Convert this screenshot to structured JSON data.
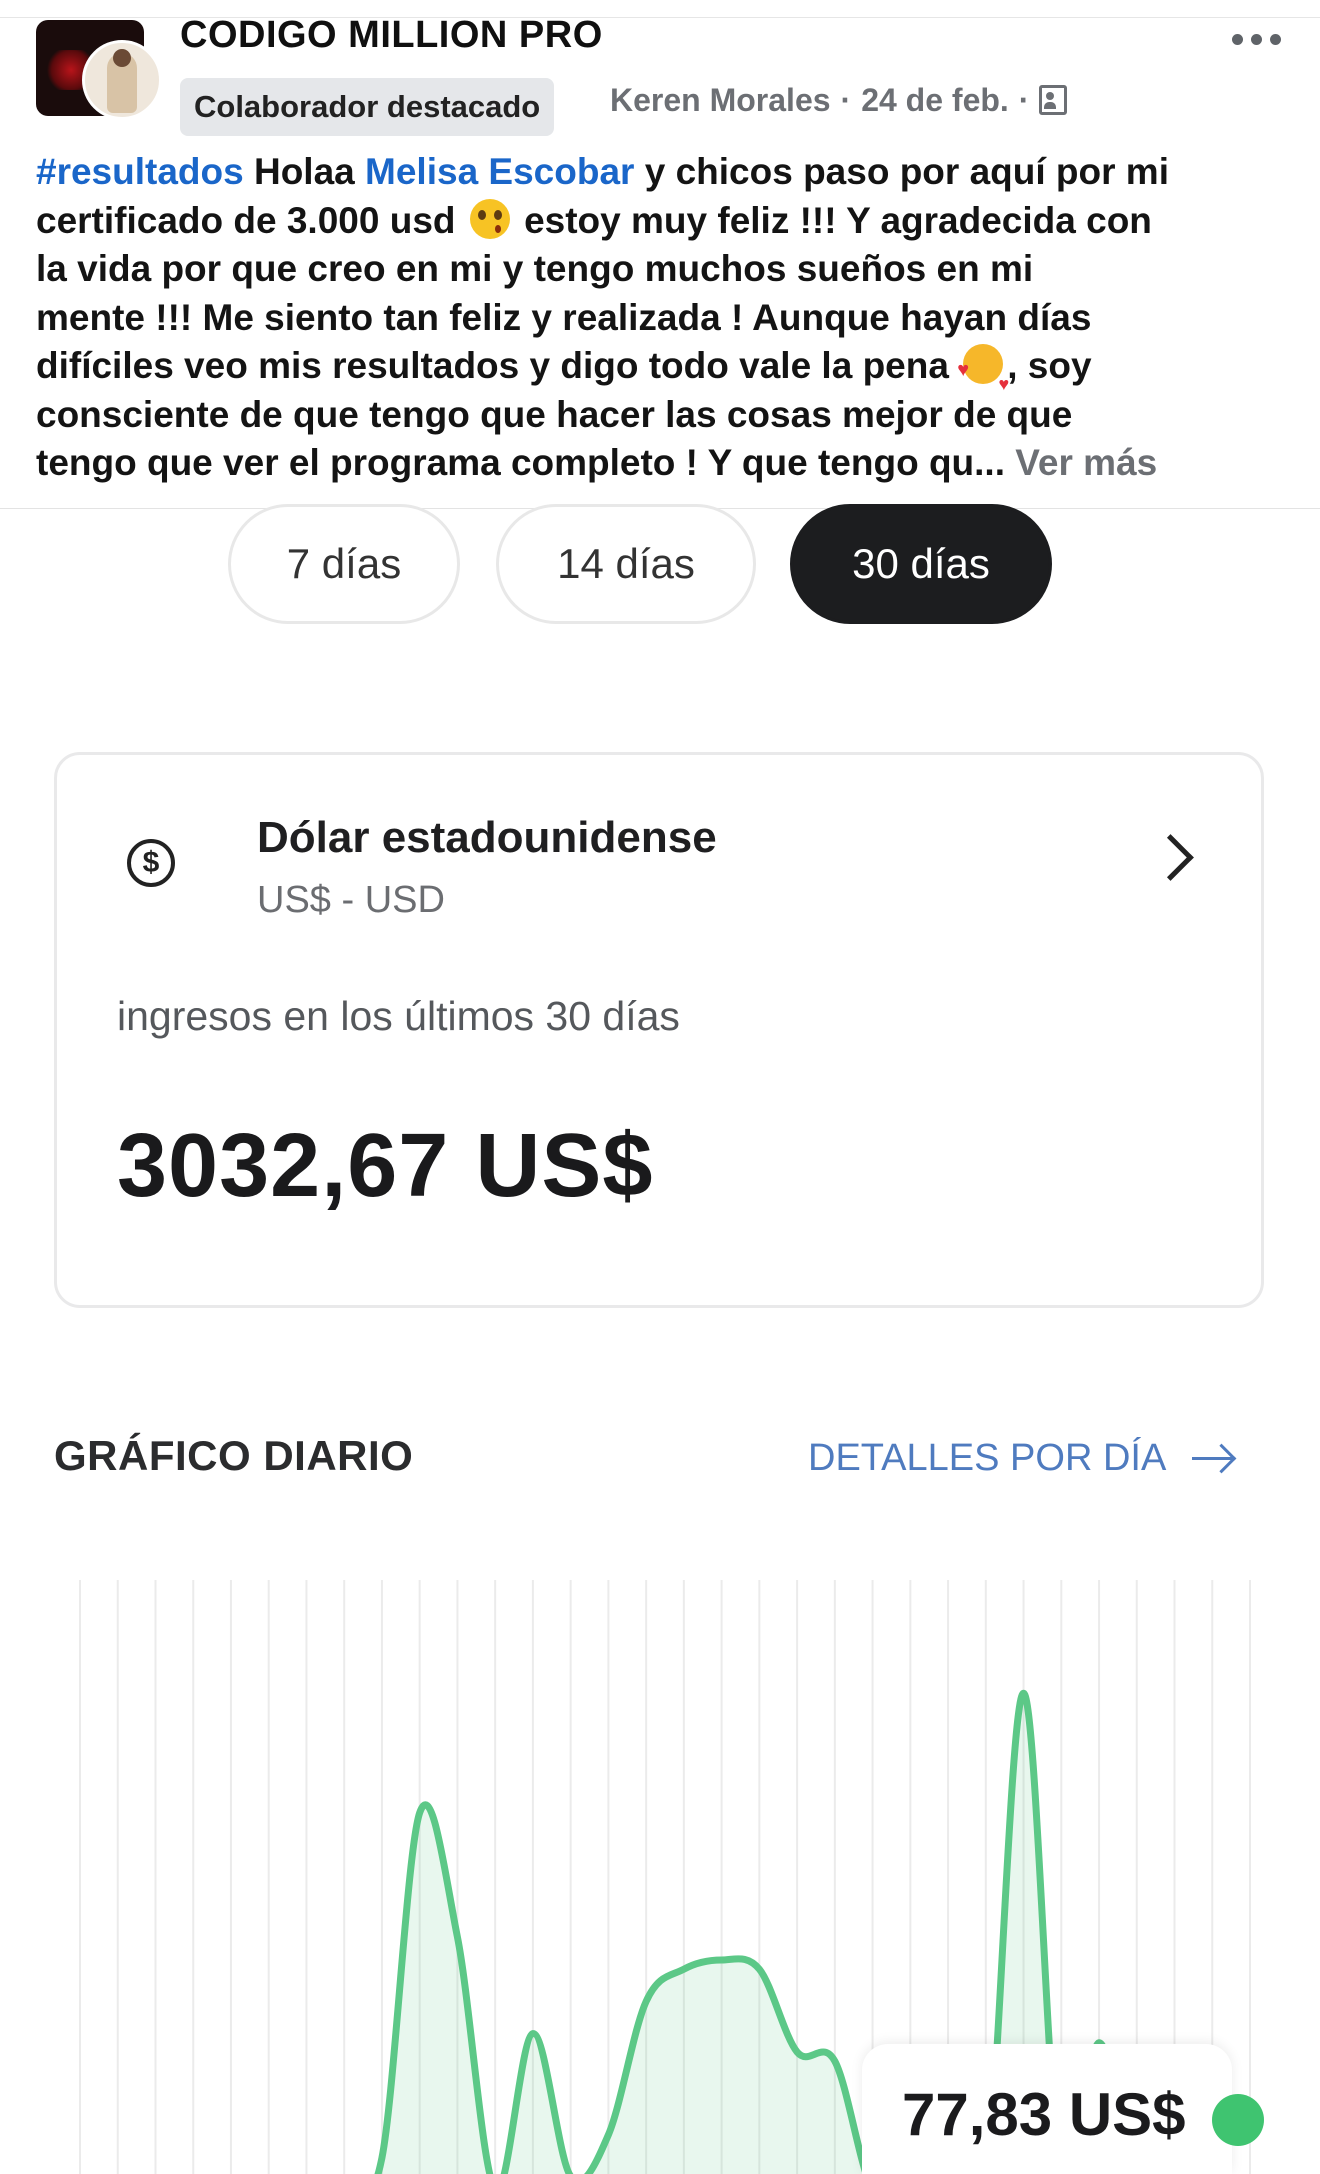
{
  "post": {
    "group_name": "CODIGO MILLION PRO",
    "badge": "Colaborador destacado",
    "author": "Keren Morales",
    "separator": "·",
    "date": "24 de feb.",
    "text_lines": [
      [
        "#resultados",
        " Holaa ",
        "Melisa Escobar",
        " y chicos paso por aquí por mi"
      ],
      [
        "certificado de 3.000 usd ",
        "",
        " estoy muy feliz !!! Y agradecida con"
      ],
      [
        "la vida por que creo en mi y tengo muchos sueños en mi"
      ],
      [
        "mente !!! Me siento tan feliz y realizada ! Aunque hayan días"
      ],
      [
        "difíciles veo mis resultados y digo todo vale la pena ",
        "",
        ", soy"
      ],
      [
        "consciente de que tengo que hacer las cosas mejor de que"
      ],
      [
        "tengo que ver el programa completo ! Y que tengo qu... ",
        "Ver más"
      ]
    ],
    "hashtag": "#resultados",
    "mention": "Melisa Escobar",
    "see_more": "Ver más",
    "icons": {
      "more": "more-horizontal-icon",
      "privacy": "group-members-icon",
      "emoji_1": "loudly-crying-face-emoji",
      "emoji_2": "smiling-face-with-hearts-emoji"
    }
  },
  "range_tabs": [
    {
      "label": "7 días",
      "active": false
    },
    {
      "label": "14 días",
      "active": false
    },
    {
      "label": "30 días",
      "active": true
    }
  ],
  "currency": {
    "name": "Dólar estadounidense",
    "code": "US$ - USD",
    "icon": "dollar-circle-icon",
    "income_label": "ingresos en los últimos 30 días",
    "income_value": "3032,67 US$"
  },
  "daily_chart": {
    "title": "GRÁFICO DIARIO",
    "details_link": "DETALLES POR DÍA",
    "tooltip_value": "77,83 US$",
    "line_color": "#5cc887",
    "dot_color": "#3fc470"
  },
  "chart_data": {
    "type": "area",
    "title": "GRÁFICO DIARIO",
    "x": [
      0,
      1,
      2,
      3,
      4,
      5,
      6,
      7,
      8,
      9,
      10,
      11,
      12,
      13,
      14,
      15,
      16,
      17,
      18,
      19,
      20,
      21,
      22,
      23,
      24,
      25,
      26,
      27,
      28,
      29,
      30,
      31
    ],
    "values": [
      0,
      0,
      0,
      0,
      0,
      0,
      0,
      0,
      7,
      82,
      55,
      0,
      34,
      3,
      12,
      41,
      48,
      50,
      48,
      30,
      28,
      0,
      0,
      0,
      0,
      108,
      0,
      32,
      1,
      18,
      0,
      0
    ],
    "ylim": [
      0,
      120
    ],
    "grid": "vertical",
    "highlighted_value": "77,83 US$"
  }
}
